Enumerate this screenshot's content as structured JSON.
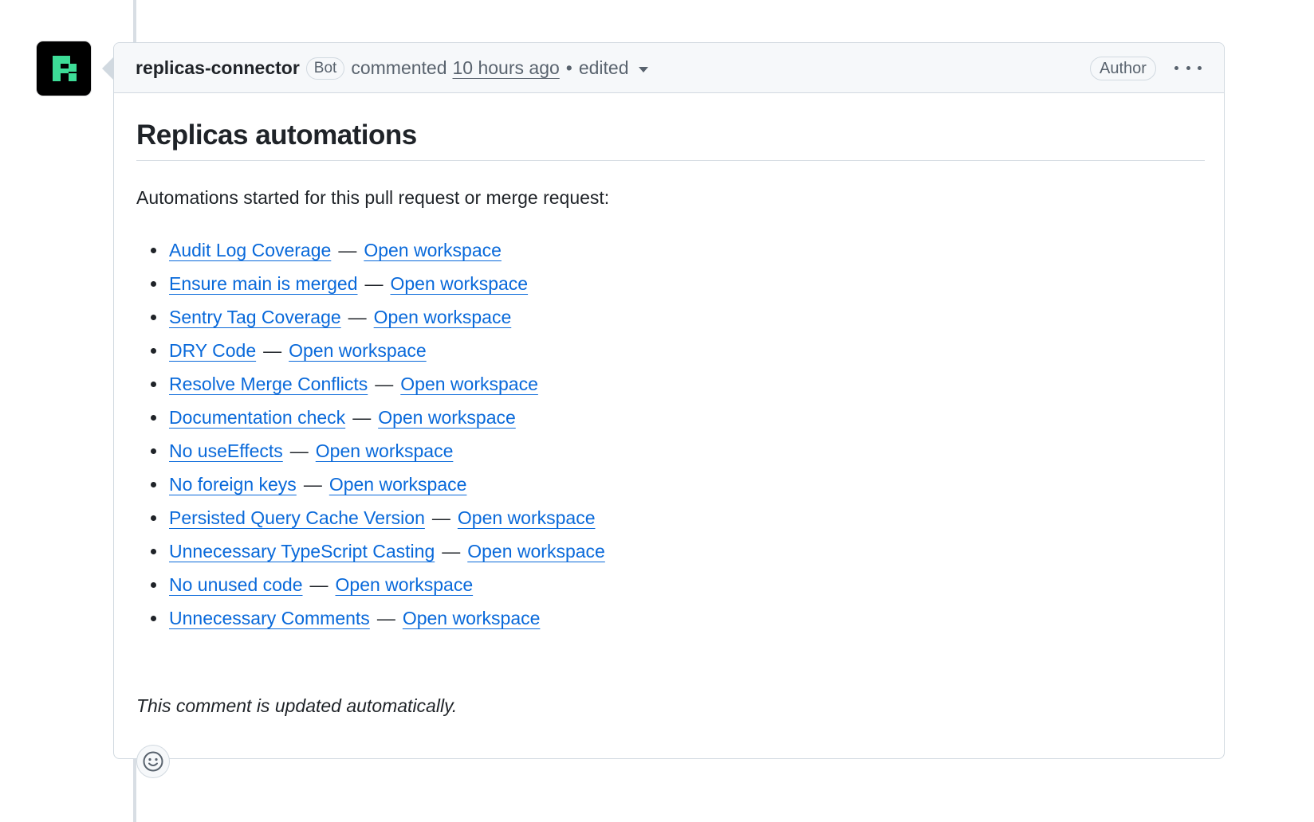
{
  "comment": {
    "author": "replicas-connector",
    "bot_badge": "Bot",
    "action": "commented",
    "timestamp": "10 hours ago",
    "separator": "•",
    "edited_label": "edited",
    "author_badge": "Author",
    "avatar_icon": "replicas-logo",
    "menu_icon": "kebab-horizontal-icon"
  },
  "body": {
    "title": "Replicas automations",
    "intro": "Automations started for this pull request or merge request:",
    "dash": "—",
    "automations": [
      {
        "name": "Audit Log Coverage",
        "link": "Open workspace"
      },
      {
        "name": "Ensure main is merged",
        "link": "Open workspace"
      },
      {
        "name": "Sentry Tag Coverage",
        "link": "Open workspace"
      },
      {
        "name": "DRY Code",
        "link": "Open workspace"
      },
      {
        "name": "Resolve Merge Conflicts",
        "link": "Open workspace"
      },
      {
        "name": "Documentation check",
        "link": "Open workspace"
      },
      {
        "name": "No useEffects",
        "link": "Open workspace"
      },
      {
        "name": "No foreign keys",
        "link": "Open workspace"
      },
      {
        "name": "Persisted Query Cache Version",
        "link": "Open workspace"
      },
      {
        "name": "Unnecessary TypeScript Casting",
        "link": "Open workspace"
      },
      {
        "name": "No unused code",
        "link": "Open workspace"
      },
      {
        "name": "Unnecessary Comments",
        "link": "Open workspace"
      }
    ],
    "footer": "This comment is updated automatically."
  },
  "reactions": {
    "icon": "smiley-icon"
  },
  "colors": {
    "link": "#0969da",
    "text": "#1f2328",
    "muted": "#59636e",
    "border": "#d1d9e0",
    "header_bg": "#f6f8fa",
    "logo_green": "#3ddc97"
  }
}
